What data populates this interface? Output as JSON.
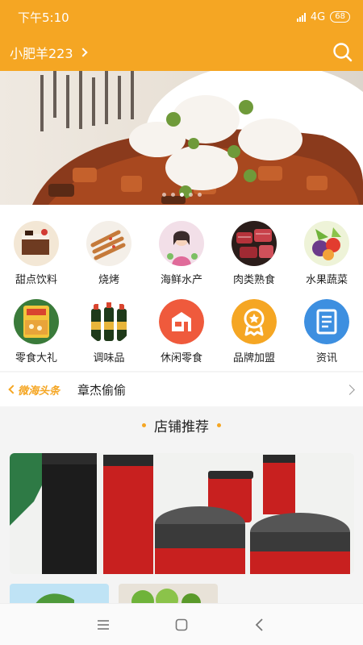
{
  "status": {
    "time": "下午5:10",
    "network": "4G",
    "battery": "68"
  },
  "header": {
    "user_name": "小肥羊223",
    "search_icon": "search-icon"
  },
  "banner": {
    "pages": 5,
    "active_page": 2
  },
  "categories": [
    {
      "label": "甜点饮料",
      "icon": "dessert-photo"
    },
    {
      "label": "烧烤",
      "icon": "bbq-photo"
    },
    {
      "label": "海鲜水产",
      "icon": "seafood-photo"
    },
    {
      "label": "肉类熟食",
      "icon": "meat-photo"
    },
    {
      "label": "水果蔬菜",
      "icon": "fruit-photo"
    },
    {
      "label": "零食大礼",
      "icon": "snack-photo"
    },
    {
      "label": "调味品",
      "icon": "seasoning-photo"
    },
    {
      "label": "休闲零食",
      "icon": "shop-icon"
    },
    {
      "label": "品牌加盟",
      "icon": "award-icon"
    },
    {
      "label": "资讯",
      "icon": "document-icon"
    }
  ],
  "news": {
    "logo_text": "微海头条",
    "headline": "章杰偷偷"
  },
  "section": {
    "title": "店铺推荐"
  },
  "colors": {
    "brand": "#f5a623",
    "blue": "#3d8fe0",
    "red": "#ef5a3c"
  }
}
